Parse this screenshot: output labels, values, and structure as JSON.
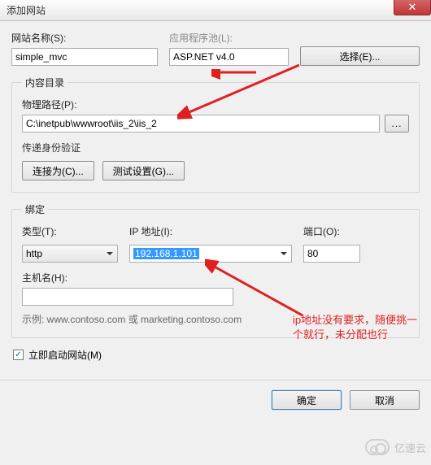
{
  "window": {
    "title": "添加网站",
    "close_glyph": "✕"
  },
  "site_name": {
    "label": "网站名称(S):",
    "value": "simple_mvc"
  },
  "app_pool": {
    "label": "应用程序池(L):",
    "value": "ASP.NET v4.0",
    "select_btn": "选择(E)..."
  },
  "content": {
    "legend": "内容目录",
    "phys_path_label": "物理路径(P):",
    "phys_path_value": "C:\\inetpub\\wwwroot\\iis_2\\iis_2",
    "browse_btn": "...",
    "passthru_label": "传递身份验证",
    "connect_as_btn": "连接为(C)...",
    "test_btn": "测试设置(G)..."
  },
  "binding": {
    "legend": "绑定",
    "type_label": "类型(T):",
    "type_value": "http",
    "ip_label": "IP 地址(I):",
    "ip_value": "192.168.1.101",
    "port_label": "端口(O):",
    "port_value": "80",
    "host_label": "主机名(H):",
    "host_value": "",
    "example": "示例: www.contoso.com 或 marketing.contoso.com"
  },
  "start_immediately": {
    "label": "立即启动网站(M)",
    "checked": true
  },
  "footer": {
    "ok": "确定",
    "cancel": "取消"
  },
  "annotation": {
    "text": "ip地址没有要求，随便挑一个就行，未分配也行"
  },
  "watermark": "亿速云"
}
